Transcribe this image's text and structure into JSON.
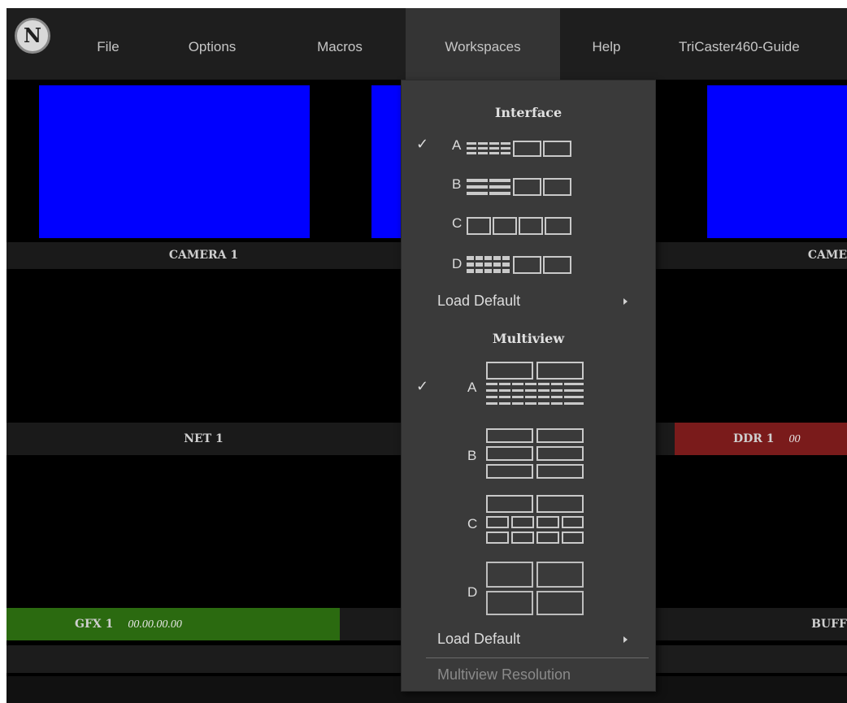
{
  "menubar": {
    "logo_letter": "N",
    "items": [
      {
        "label": "File"
      },
      {
        "label": "Options"
      },
      {
        "label": "Macros"
      },
      {
        "label": "Workspaces"
      },
      {
        "label": "Help"
      },
      {
        "label": "TriCaster460-Guide"
      }
    ]
  },
  "monitors": {
    "row1": [
      "CAMERA 1",
      "CAME"
    ],
    "row2": [
      "NET 1",
      "DDR 1",
      "00"
    ],
    "row3": [
      "GFX 1",
      "00.00.00.00",
      "BUFF"
    ]
  },
  "dropdown": {
    "interface_header": "Interface",
    "interface_options": [
      {
        "letter": "A",
        "checked": true
      },
      {
        "letter": "B",
        "checked": false
      },
      {
        "letter": "C",
        "checked": false
      },
      {
        "letter": "D",
        "checked": false
      }
    ],
    "load_default_label": "Load Default",
    "multiview_header": "Multiview",
    "multiview_options": [
      {
        "letter": "A",
        "checked": true
      },
      {
        "letter": "B",
        "checked": false
      },
      {
        "letter": "C",
        "checked": false
      },
      {
        "letter": "D",
        "checked": false
      }
    ],
    "load_default_label_2": "Load Default",
    "multiview_resolution_label": "Multiview Resolution",
    "check_mark": "✓"
  },
  "colors": {
    "monitor_blue": "#0000ff",
    "gfx_green": "#2b6a10",
    "ddr_red": "#7a1b1b",
    "menu_active": "#343434"
  }
}
